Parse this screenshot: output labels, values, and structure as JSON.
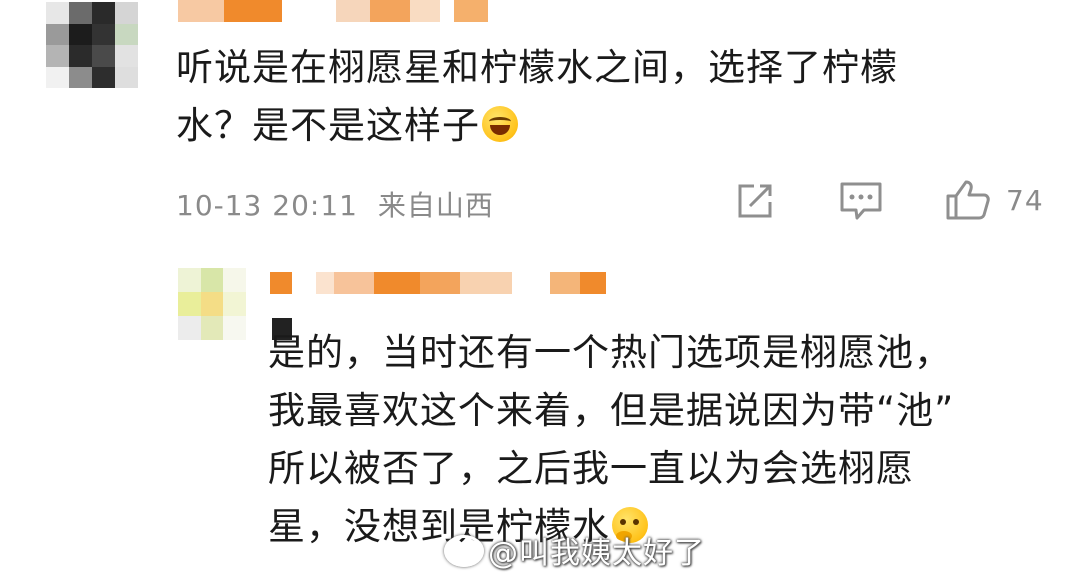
{
  "comment1": {
    "text_line1": "听说是在栩愿星和柠檬水之间，选择了柠檬",
    "text_line2": "水？是不是这样子",
    "timestamp": "10-13 20:11",
    "location": "来自山西",
    "like_count": "74"
  },
  "reply": {
    "line1": "是的，当时还有一个热门选项是栩愿池，",
    "line2": "我最喜欢这个来着，但是据说因为带“池”",
    "line3": "所以被否了，之后我一直以为会选栩愿",
    "line4": "星，没想到是柠檬水"
  },
  "watermark": {
    "text": "@叫我姨太好了"
  },
  "colors": {
    "text": "#1a1a1a",
    "meta": "#8a8a8a",
    "icon": "#8f8f8f",
    "mosaic_orange": "#f08a2c"
  }
}
